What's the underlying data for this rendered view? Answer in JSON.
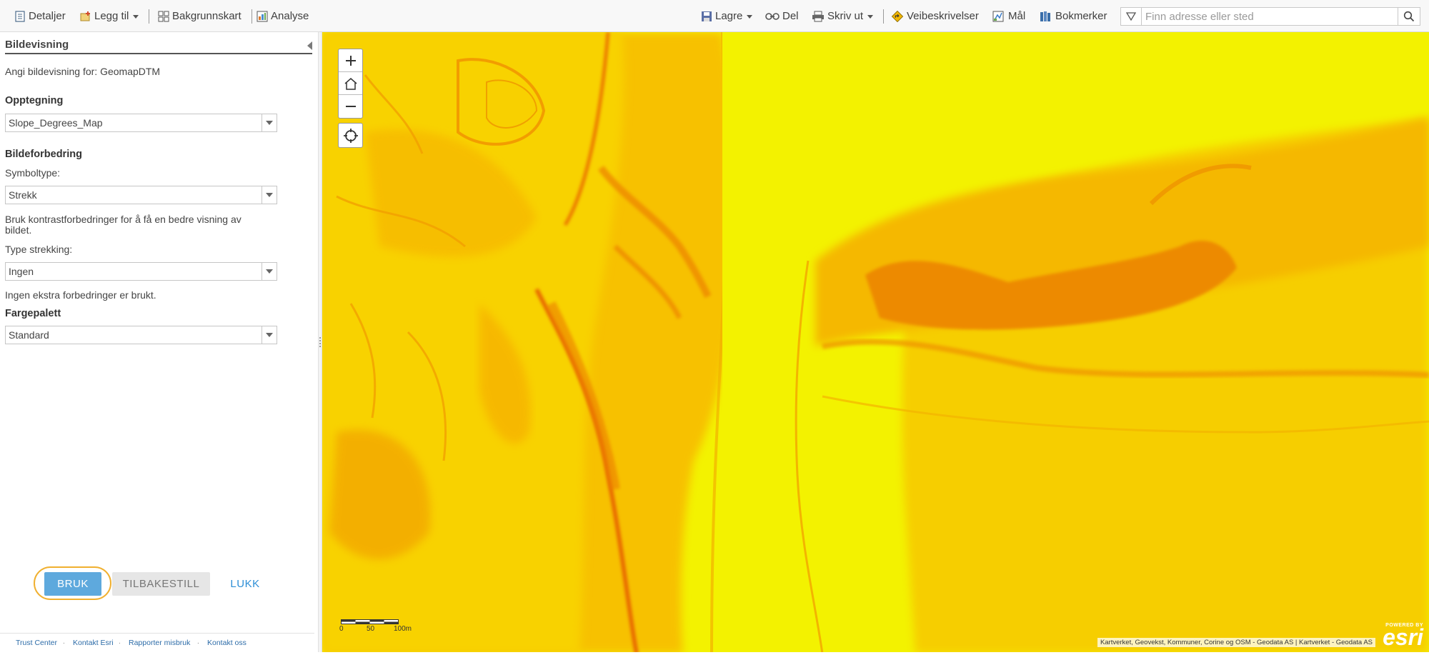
{
  "toolbar": {
    "left": [
      {
        "label": "Detaljer",
        "icon": "details-icon"
      },
      {
        "label": "Legg til",
        "icon": "add-icon",
        "dropdown": true
      },
      {
        "label": "Bakgrunnskart",
        "icon": "basemap-icon"
      },
      {
        "label": "Analyse",
        "icon": "analysis-icon"
      }
    ],
    "right": [
      {
        "label": "Lagre",
        "icon": "save-icon",
        "dropdown": true
      },
      {
        "label": "Del",
        "icon": "share-icon"
      },
      {
        "label": "Skriv ut",
        "icon": "print-icon",
        "dropdown": true
      },
      {
        "label": "Veibeskrivelser",
        "icon": "directions-icon"
      },
      {
        "label": "Mål",
        "icon": "measure-icon"
      },
      {
        "label": "Bokmerker",
        "icon": "bookmarks-icon"
      }
    ],
    "search_placeholder": "Finn adresse eller sted"
  },
  "panel": {
    "title": "Bildevisning",
    "subtitle": "Angi bildevisning for: GeomapDTM",
    "rendering_heading": "Opptegning",
    "rendering_value": "Slope_Degrees_Map",
    "enhance_heading": "Bildeforbedring",
    "symbol_type_label": "Symboltype:",
    "symbol_type_value": "Strekk",
    "contrast_hint": "Bruk kontrastforbedringer for å få en bedre visning av bildet.",
    "stretch_type_label": "Type strekking:",
    "stretch_type_value": "Ingen",
    "no_enhance_text": "Ingen ekstra forbedringer er brukt.",
    "palette_heading": "Fargepalett",
    "palette_value": "Standard",
    "buttons": {
      "apply": "BRUK",
      "reset": "TILBAKESTILL",
      "close": "LUKK"
    },
    "footer_links": [
      "Trust Center",
      "Kontakt Esri",
      "Rapporter misbruk",
      "Kontakt oss"
    ]
  },
  "map": {
    "scale_labels": [
      "0",
      "50",
      "100m"
    ],
    "attribution": "Kartverket, Geovekst, Kommuner, Corine og OSM - Geodata AS | Kartverket - Geodata AS",
    "logo_small": "POWERED BY",
    "logo": "esri",
    "colors": {
      "flat": "#f3f200",
      "mid": "#f6b400",
      "steep": "#ec7a00",
      "steepest": "#e45a00"
    }
  }
}
